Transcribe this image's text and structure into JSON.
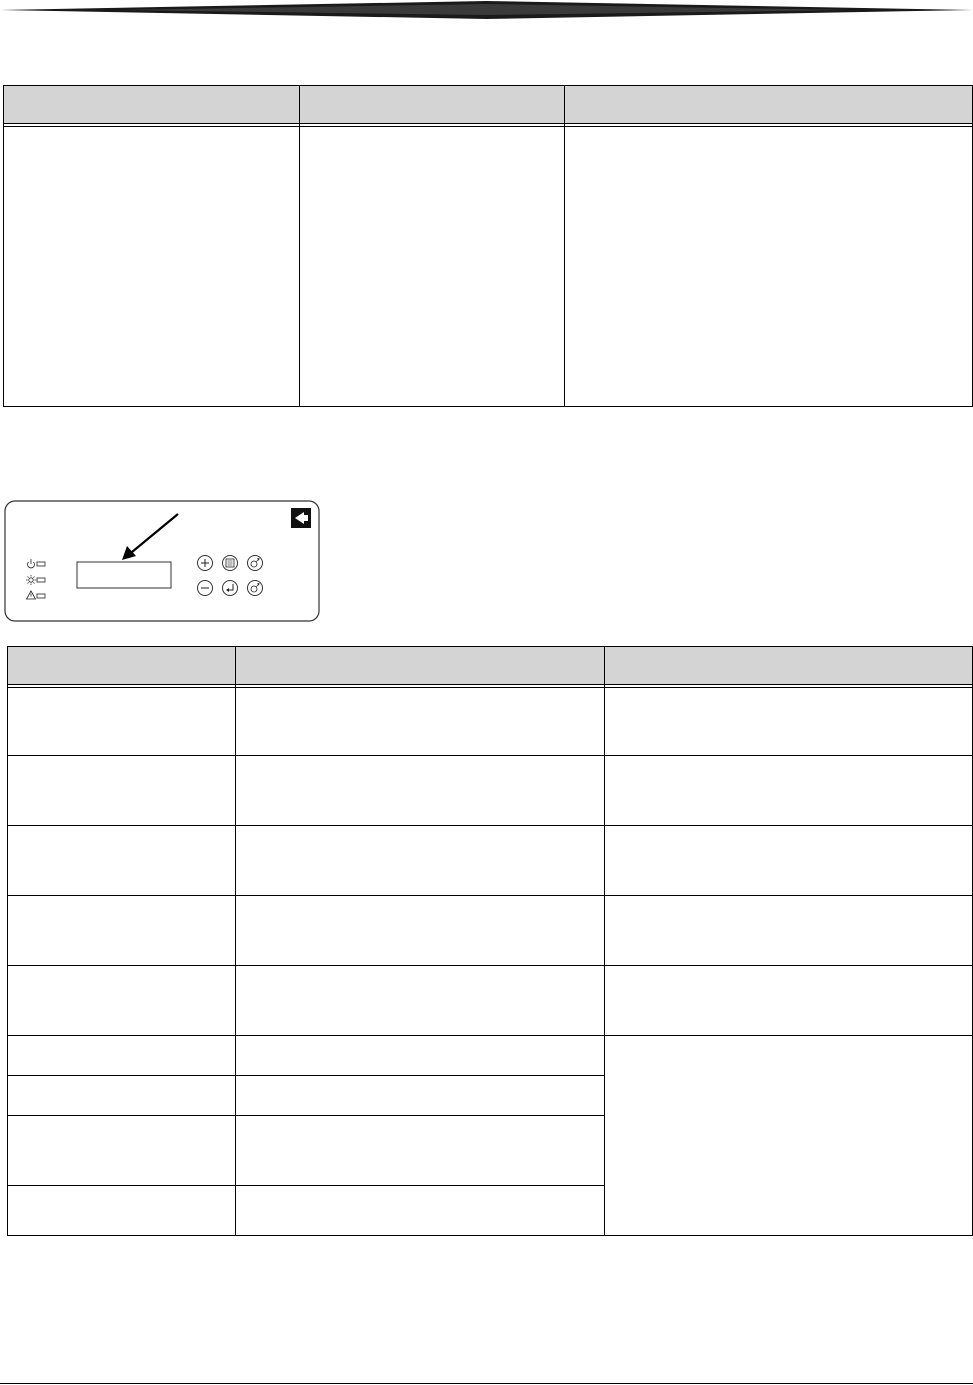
{
  "panel": {
    "icons": [
      "power-icon",
      "light-icon",
      "warning-icon",
      "plus-icon",
      "menu-icon",
      "settings-icon",
      "minus-icon",
      "enter-icon",
      "settings-alt-icon",
      "kodak-logo-icon"
    ],
    "display_text": ""
  },
  "table_top": {
    "columns": [
      "",
      "",
      ""
    ],
    "rows": [
      [
        "",
        "",
        ""
      ]
    ]
  },
  "table_bottom": {
    "columns": [
      "",
      "",
      ""
    ],
    "rows": [
      [
        "",
        "",
        ""
      ],
      [
        "",
        "",
        ""
      ],
      [
        "",
        "",
        ""
      ],
      [
        "",
        "",
        ""
      ],
      [
        "",
        "",
        ""
      ],
      [
        "",
        "",
        ""
      ],
      [
        "",
        ""
      ],
      [
        "",
        ""
      ],
      [
        "",
        ""
      ]
    ]
  }
}
